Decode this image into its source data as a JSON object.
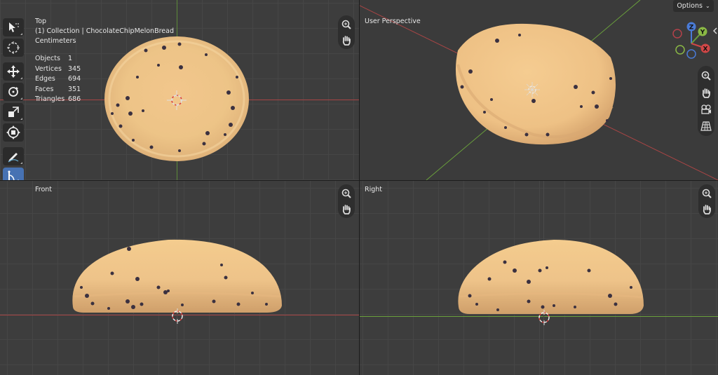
{
  "header": {
    "options_label": "Options"
  },
  "viewports": {
    "top": {
      "title": "Top",
      "collection": "(1) Collection | ChocolateChipMelonBread",
      "units": "Centimeters",
      "stats": [
        {
          "label": "Objects",
          "value": "1"
        },
        {
          "label": "Vertices",
          "value": "345"
        },
        {
          "label": "Edges",
          "value": "694"
        },
        {
          "label": "Faces",
          "value": "351"
        },
        {
          "label": "Triangles",
          "value": "686"
        }
      ]
    },
    "perspective": {
      "title": "User Perspective"
    },
    "front": {
      "title": "Front"
    },
    "right": {
      "title": "Right"
    }
  },
  "gizmo": {
    "x": "X",
    "y": "Y",
    "z": "Z"
  },
  "toolbar": {
    "tools": [
      "select-box-icon",
      "cursor-icon",
      "move-icon",
      "rotate-icon",
      "scale-icon",
      "transform-icon",
      "annotate-icon",
      "measure-icon",
      "add-cube-icon",
      "shear-icon"
    ],
    "active": "measure-icon"
  },
  "colors": {
    "accent": "#4772b3",
    "axis_x": "#a84545",
    "axis_y": "#6aa03c",
    "axis_z": "#4a7bd6"
  }
}
